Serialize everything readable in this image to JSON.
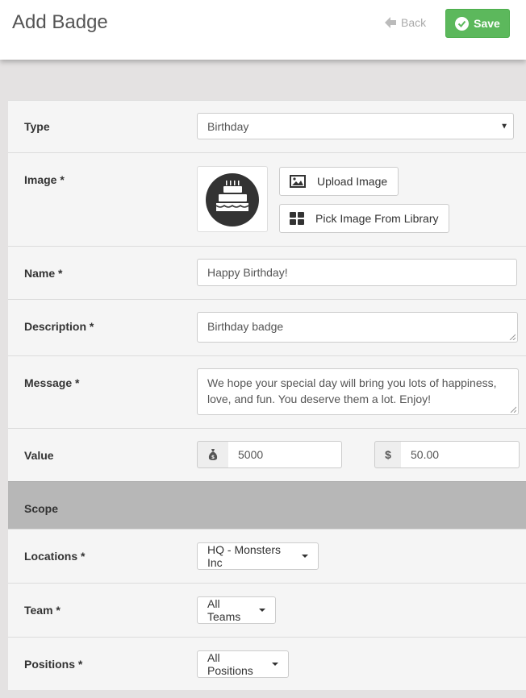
{
  "header": {
    "title": "Add Badge",
    "back_label": "Back",
    "save_label": "Save"
  },
  "form": {
    "type": {
      "label": "Type",
      "value": "Birthday"
    },
    "image": {
      "label": "Image *",
      "upload_label": "Upload Image",
      "library_label": "Pick Image From Library"
    },
    "name": {
      "label": "Name *",
      "value": "Happy Birthday!"
    },
    "description": {
      "label": "Description *",
      "value": "Birthday badge"
    },
    "message": {
      "label": "Message *",
      "value": "We hope your special day will bring you lots of happiness, love, and fun. You deserve them a lot. Enjoy!"
    },
    "value": {
      "label": "Value",
      "points": "5000",
      "currency_symbol": "$",
      "amount": "50.00"
    }
  },
  "scope": {
    "header": "Scope",
    "locations": {
      "label": "Locations *",
      "value": "HQ - Monsters Inc"
    },
    "team": {
      "label": "Team *",
      "value": "All Teams"
    },
    "positions": {
      "label": "Positions *",
      "value": "All Positions"
    }
  },
  "colors": {
    "save_green": "#5cb85c",
    "scope_gray": "#b7b7b7",
    "badge_dark": "#333333"
  },
  "icons": {
    "back": "arrow-left-icon",
    "save": "check-circle-icon",
    "upload": "image-icon",
    "library": "grid-icon",
    "points": "money-bag-icon",
    "badge": "birthday-cake-icon"
  }
}
